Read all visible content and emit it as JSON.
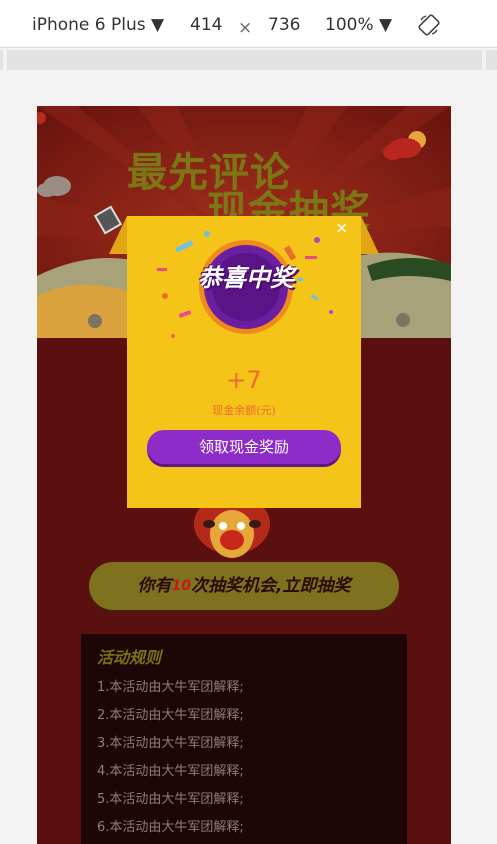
{
  "toolbar": {
    "device": "iPhone 6 Plus ▼",
    "width": "414",
    "times": "×",
    "height": "736",
    "zoom": "100% ▼",
    "rotate_icon": "rotate-icon"
  },
  "banner": {
    "title_line1": "最先评论",
    "title_line2": "现金抽奖"
  },
  "popup": {
    "close": "×",
    "title": "恭喜中奖",
    "amount": "+7",
    "amount_label": "现金余额(元)",
    "claim_label": "领取现金奖励"
  },
  "draw": {
    "prefix": "你有",
    "count": "10",
    "suffix": "次抽奖机会,立即抽奖"
  },
  "rules": {
    "title": "活动规则",
    "items": [
      "1.本活动由大牛军团解释;",
      "2.本活动由大牛军团解释;",
      "3.本活动由大牛军团解释;",
      "4.本活动由大牛军团解释;",
      "5.本活动由大牛军团解释;",
      "6.本活动由大牛军团解释;"
    ]
  },
  "colors": {
    "banner_bg": "#7a1a14",
    "page_bg": "#5b1010",
    "popup_bg": "#f5c418",
    "claim_btn": "#8d2cc7",
    "accent_orange": "#ef6a32",
    "title_olive": "#7c7614"
  }
}
